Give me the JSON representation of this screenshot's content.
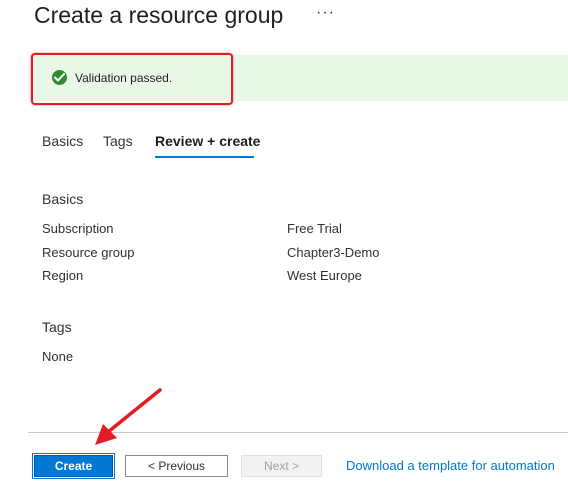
{
  "header": {
    "title": "Create a resource group",
    "more_glyph": "···"
  },
  "validation": {
    "message": "Validation passed.",
    "status_color": "#2f8a2f",
    "icon": "check-circle-icon"
  },
  "tabs": [
    {
      "label": "Basics",
      "active": false
    },
    {
      "label": "Tags",
      "active": false
    },
    {
      "label": "Review + create",
      "active": true
    }
  ],
  "review": {
    "basics_heading": "Basics",
    "rows": [
      {
        "label": "Subscription",
        "value": "Free Trial"
      },
      {
        "label": "Resource group",
        "value": "Chapter3-Demo"
      },
      {
        "label": "Region",
        "value": "West Europe"
      }
    ],
    "tags_heading": "Tags",
    "tags_value": "None"
  },
  "footer": {
    "create_label": "Create",
    "previous_label": "< Previous",
    "next_label": "Next >",
    "template_link": "Download a template for automation"
  },
  "colors": {
    "accent": "#0078d4",
    "annotation": "#e31b23",
    "banner_bg": "#e9f7e6"
  }
}
